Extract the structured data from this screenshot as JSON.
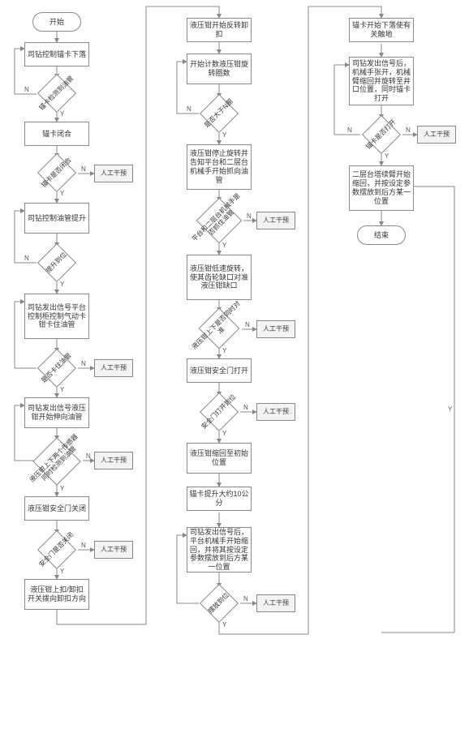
{
  "chart_data": {
    "type": "flowchart",
    "title": "",
    "columns": 3,
    "nodes": [
      {
        "id": "start",
        "col": 1,
        "type": "terminator",
        "text": "开始"
      },
      {
        "id": "p1",
        "col": 1,
        "type": "process",
        "text": "司钻控制锚卡下落"
      },
      {
        "id": "d1",
        "col": 1,
        "type": "decision",
        "text": "锚卡检测到油管",
        "yes": "p2",
        "no_loop": true
      },
      {
        "id": "p2",
        "col": 1,
        "type": "process",
        "text": "锚卡闭合"
      },
      {
        "id": "d2",
        "col": 1,
        "type": "decision",
        "text": "锚卡是否闭合",
        "yes": "p3",
        "no": "int1"
      },
      {
        "id": "int1",
        "col": 1,
        "type": "intervene",
        "text": "人工干预"
      },
      {
        "id": "p3",
        "col": 1,
        "type": "process",
        "text": "司钻控制油管提升"
      },
      {
        "id": "d3",
        "col": 1,
        "type": "decision",
        "text": "提升到位",
        "yes": "p4",
        "no_loop": true
      },
      {
        "id": "p4",
        "col": 1,
        "type": "process",
        "text": "司钻发出信号平台控制柜控制气动卡钳卡住油管"
      },
      {
        "id": "d4",
        "col": 1,
        "type": "decision",
        "text": "是否卡住油管",
        "yes": "p5",
        "no": "int2"
      },
      {
        "id": "int2",
        "col": 1,
        "type": "intervene",
        "text": "人工干预"
      },
      {
        "id": "p5",
        "col": 1,
        "type": "process",
        "text": "司钻发出信号液压钳开始伸向油管"
      },
      {
        "id": "d5",
        "col": 1,
        "type": "decision",
        "text": "液压钳上下两个传感器同时检测到油管",
        "yes": "p6",
        "no": "int3"
      },
      {
        "id": "int3",
        "col": 1,
        "type": "intervene",
        "text": "人工干预"
      },
      {
        "id": "p6",
        "col": 1,
        "type": "process",
        "text": "液压钳安全门关闭"
      },
      {
        "id": "d6",
        "col": 1,
        "type": "decision",
        "text": "安全门是否关闭",
        "yes": "p7",
        "no": "int4"
      },
      {
        "id": "int4",
        "col": 1,
        "type": "intervene",
        "text": "人工干预"
      },
      {
        "id": "p7",
        "col": 1,
        "type": "process",
        "text": "液压钳上扣/卸扣开关拨向卸扣方向"
      },
      {
        "id": "p8",
        "col": 2,
        "type": "process",
        "text": "液压钳开始反转卸扣"
      },
      {
        "id": "p9",
        "col": 2,
        "type": "process",
        "text": "开始计数液压钳旋转圈数"
      },
      {
        "id": "d7",
        "col": 2,
        "type": "decision",
        "text": "是否大于N圈",
        "yes": "p10",
        "no_loop": true
      },
      {
        "id": "p10",
        "col": 2,
        "type": "process",
        "text": "液压钳停止旋转并告知平台和二层台机械手开始抓向油管"
      },
      {
        "id": "d8",
        "col": 2,
        "type": "decision",
        "text": "平台和二层台机械手是否抓住油管",
        "yes": "p11",
        "no": "int5"
      },
      {
        "id": "int5",
        "col": 2,
        "type": "intervene",
        "text": "人工干预"
      },
      {
        "id": "p11",
        "col": 2,
        "type": "process",
        "text": "液压钳低速旋转，使其齿轮缺口对准液压钳缺口"
      },
      {
        "id": "d9",
        "col": 2,
        "type": "decision",
        "text": "液压钳上下是否同时对准",
        "yes": "p12",
        "no": "int6"
      },
      {
        "id": "int6",
        "col": 2,
        "type": "intervene",
        "text": "人工干预"
      },
      {
        "id": "p12",
        "col": 2,
        "type": "process",
        "text": "液压钳安全门打开"
      },
      {
        "id": "d10",
        "col": 2,
        "type": "decision",
        "text": "安全门打开到位",
        "yes": "p13",
        "no": "int7"
      },
      {
        "id": "int7",
        "col": 2,
        "type": "intervene",
        "text": "人工干预"
      },
      {
        "id": "p13",
        "col": 2,
        "type": "process",
        "text": "液压钳缩回至初始位置"
      },
      {
        "id": "p14",
        "col": 2,
        "type": "process",
        "text": "锚卡提升大约10公分"
      },
      {
        "id": "p15",
        "col": 2,
        "type": "process",
        "text": "司钻发出信号后，平台机械手开始缩回，并将其按设定参数摆放到后方某一位置"
      },
      {
        "id": "d11",
        "col": 2,
        "type": "decision",
        "text": "摆放到位",
        "yes": "p16",
        "no": "int8"
      },
      {
        "id": "int8",
        "col": 2,
        "type": "intervene",
        "text": "人工干预"
      },
      {
        "id": "p16",
        "col": 3,
        "type": "process",
        "text": "锚卡开始下落使有关触地"
      },
      {
        "id": "p17",
        "col": 3,
        "type": "process",
        "text": "司钻发出信号后，机械手张开，机械臂缩回并旋转至井口位置，同时锚卡打开"
      },
      {
        "id": "d12",
        "col": 3,
        "type": "decision",
        "text": "锚卡是否打开",
        "yes": "p18",
        "no": "int9"
      },
      {
        "id": "int9",
        "col": 3,
        "type": "intervene",
        "text": "人工干预"
      },
      {
        "id": "p18",
        "col": 3,
        "type": "process",
        "text": "二层台塔续臂开始缩回，并按设定参数摆放到后方某一位置"
      },
      {
        "id": "end",
        "col": 3,
        "type": "terminator",
        "text": "结束"
      }
    ],
    "global_no_loop": "从部分决策N返回上一步骤或人工干预",
    "column3_Y_arc": "d12的Y分支长弧线返回流程下游"
  },
  "labels": {
    "yes": "Y",
    "no": "N"
  },
  "intervene_label": "人工干预"
}
